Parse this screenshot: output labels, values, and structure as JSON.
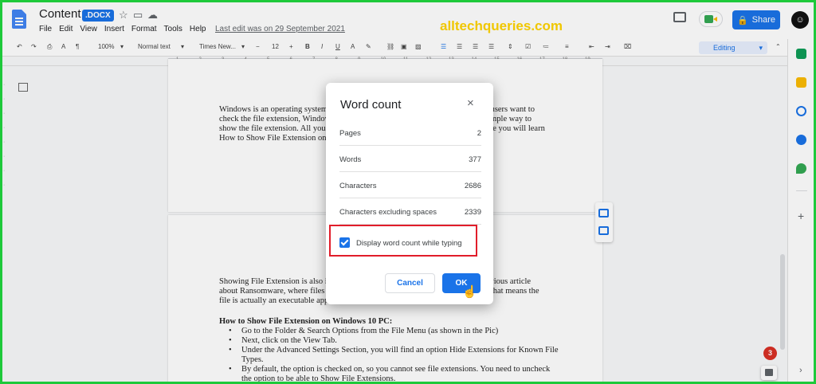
{
  "header": {
    "title": "Content",
    "badge": ".DOCX",
    "menus": [
      "File",
      "Edit",
      "View",
      "Insert",
      "Format",
      "Tools",
      "Help"
    ],
    "last_edit": "Last edit was on 29 September 2021",
    "share_label": "Share",
    "avatar_letter": "☺"
  },
  "watermark": "alltechqueries.com",
  "toolbar": {
    "zoom": "100%",
    "style": "Normal text",
    "font": "Times New...",
    "font_size": "12",
    "mode": "Editing"
  },
  "ruler": [
    "1",
    "2",
    "3",
    "4",
    "5",
    "6",
    "7",
    "8",
    "9",
    "10",
    "11",
    "12",
    "13",
    "14",
    "15",
    "16",
    "17",
    "18",
    "19"
  ],
  "document": {
    "page1_text": "Windows is an operating system that displays many types of files. Whenever the users want to check the file extension, Windows hides the file extension. However, there is a simple way to show the file extension. All you need to do is enable File Extensions. In this article you will learn How to Show File Extension on Windows 10.",
    "page2_text": "Showing File Extension is also important for security. We covered this in our previous article about Ransomware, where files look like filename.mp4.exe or filename.doc.exe, that means the file is actually an executable application.",
    "heading": "How to Show File Extension on Windows 10 PC:",
    "bullets": [
      "Go to the Folder & Search Options from the File Menu (as shown in the Pic)",
      "Next, click on the View Tab.",
      "Under the Advanced Settings Section, you will find an option Hide Extensions for Known File Types.",
      "By default, the option is checked on, so you cannot see file extensions. You need to uncheck the option to be able to Show File Extensions."
    ]
  },
  "dialog": {
    "title": "Word count",
    "close_icon": "×",
    "rows": [
      {
        "label": "Pages",
        "value": "2"
      },
      {
        "label": "Words",
        "value": "377"
      },
      {
        "label": "Characters",
        "value": "2686"
      },
      {
        "label": "Characters excluding spaces",
        "value": "2339"
      }
    ],
    "checkbox_label": "Display word count while typing",
    "checkbox_checked": true,
    "cancel_label": "Cancel",
    "ok_label": "OK"
  },
  "notification_count": "3",
  "colors": {
    "accent": "#1a73e8",
    "highlight_border": "#e11d2a",
    "watermark": "#ffd400",
    "frame": "#1ec93a"
  }
}
